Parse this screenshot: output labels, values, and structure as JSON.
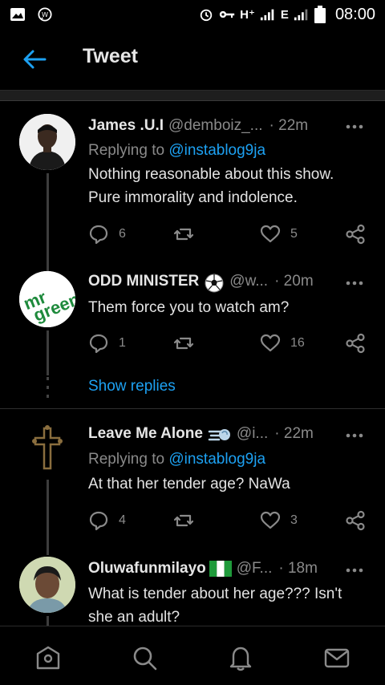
{
  "status_bar": {
    "network_label": "H⁺",
    "network2_label": "E",
    "time": "08:00"
  },
  "header": {
    "title": "Tweet"
  },
  "tweets": [
    {
      "name": "James .U.I",
      "handle": "@demboiz_...",
      "time": "· 22m",
      "replying_prefix": "Replying to ",
      "replying_handle": "@instablog9ja",
      "text": "Nothing reasonable about this show. Pure immorality and indolence.",
      "replies": "6",
      "retweets": "",
      "likes": "5"
    },
    {
      "name": "ODD MINISTER",
      "handle": "@w...",
      "time": "· 20m",
      "avatar_text": "mr green",
      "text": "Them force you to watch am?",
      "replies": "1",
      "retweets": "",
      "likes": "16",
      "show_replies": "Show replies"
    },
    {
      "name": "Leave Me Alone",
      "handle": "@i...",
      "time": "· 22m",
      "replying_prefix": "Replying to ",
      "replying_handle": "@instablog9ja",
      "text": "At that her tender age? NaWa",
      "replies": "4",
      "retweets": "",
      "likes": "3"
    },
    {
      "name": "Oluwafunmilayo",
      "handle": "@F...",
      "time": "· 18m",
      "text": "What is tender about her age??? Isn't she an adult?"
    }
  ],
  "icons": {
    "back": "arrow-left-icon",
    "more": "more-horizontal-icon",
    "reply": "reply-icon",
    "retweet": "retweet-icon",
    "like": "heart-icon",
    "share": "share-icon",
    "home": "home-icon",
    "search": "search-icon",
    "notifications": "bell-icon",
    "messages": "mail-icon"
  },
  "colors": {
    "background": "#000000",
    "accent": "#1da1f2",
    "secondary_text": "#8a8a8a"
  }
}
